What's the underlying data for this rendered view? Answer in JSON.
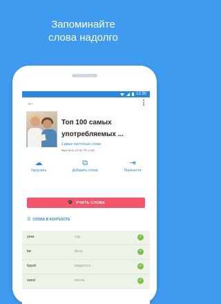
{
  "promo": {
    "line1": "Запоминайте",
    "line2": "слова надолго"
  },
  "status": {
    "time": "12:30"
  },
  "toolbar": {
    "back_glyph": "←",
    "more_glyph": "⋮"
  },
  "course": {
    "title_line1": "Топ 100 самых",
    "title_line2": "употребляемых ...",
    "subtitle": "Самые частотные слова",
    "progress_text": "Выучено 13 из 75 слов"
  },
  "actions": [
    {
      "label": "Загрузить",
      "icon": "cloud-download-icon",
      "glyph": "☁"
    },
    {
      "label": "Добавить слова",
      "icon": "add-cards-icon",
      "glyph": "⧉"
    },
    {
      "label": "Перенести",
      "icon": "move-icon",
      "glyph": "⇥"
    }
  ],
  "learn_button": {
    "label": "УЧИТЬ СЛОВА",
    "icon": "graduation-cap-icon"
  },
  "section": {
    "title": "СЛОВА В КОНТЕКСТЕ",
    "icon": "list-icon"
  },
  "words": [
    {
      "word": "year",
      "translation": "год"
    },
    {
      "word": "be",
      "translation": "быть"
    },
    {
      "word": "liquid",
      "translation": "жидкость"
    },
    {
      "word": "sand",
      "translation": "песок"
    }
  ],
  "colors": {
    "background": "#3f9bf0",
    "accent": "#2a87e0",
    "button": "#f4536b",
    "check": "#7cc142"
  }
}
